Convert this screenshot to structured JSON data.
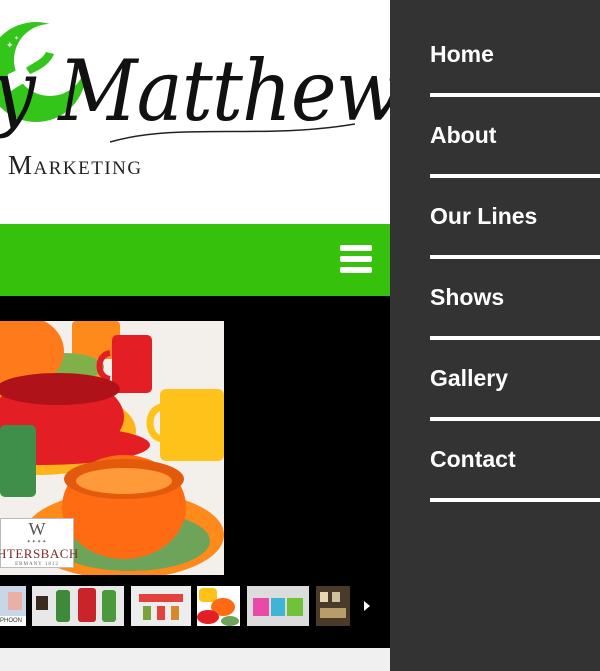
{
  "logo": {
    "script": "Matthews",
    "sub": "Marketing",
    "script_prefix": "y"
  },
  "header": {
    "menu_icon": "hamburger-icon",
    "bar_color": "#36c20c"
  },
  "slideshow": {
    "brand": {
      "letter": "W",
      "stars": "✦✦✦✦",
      "name": "HTERSBACH",
      "tagline": "ERMANY 1812"
    },
    "thumbnails": [
      {
        "name": "thumbnail-placemat",
        "caption": "PHOON"
      },
      {
        "name": "thumbnail-aprons"
      },
      {
        "name": "thumbnail-glassware"
      },
      {
        "name": "thumbnail-bowls"
      },
      {
        "name": "thumbnail-containers"
      },
      {
        "name": "thumbnail-shelf"
      }
    ],
    "next_icon": "chevron-right-icon"
  },
  "menu": {
    "items": [
      {
        "label": "Home"
      },
      {
        "label": "About"
      },
      {
        "label": "Our Lines"
      },
      {
        "label": "Shows"
      },
      {
        "label": "Gallery"
      },
      {
        "label": "Contact"
      }
    ]
  },
  "colors": {
    "menu_bg": "#333333",
    "accent_green": "#36c20c"
  }
}
